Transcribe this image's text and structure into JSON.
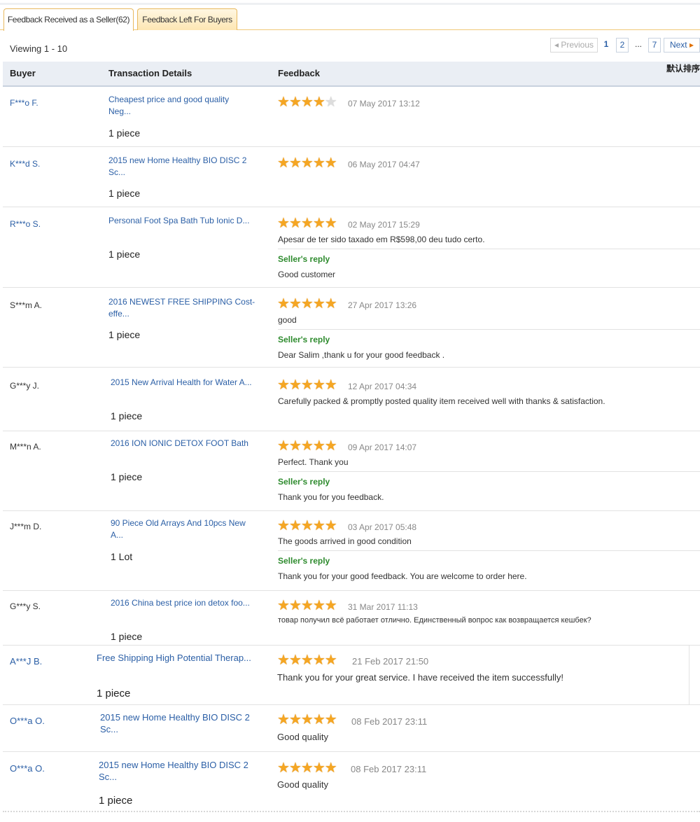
{
  "tabs": [
    {
      "label": "Feedback Received as a Seller(62)"
    },
    {
      "label": "Feedback Left For Buyers"
    }
  ],
  "viewing": "Viewing 1 - 10",
  "pager": {
    "prev": "Previous",
    "pages": [
      "1",
      "2",
      "...",
      "7"
    ],
    "next": "Next"
  },
  "columns": {
    "buyer": "Buyer",
    "transaction": "Transaction Details",
    "feedback": "Feedback",
    "sort": "默认排序"
  },
  "rows": [
    {
      "buyer": "F***o F.",
      "title1": "Cheapest price and good quality",
      "title2": "Neg...",
      "qty": "1 piece",
      "stars": 4,
      "date": "07 May 2017 13:12",
      "comment": "",
      "reply_label": "",
      "reply": ""
    },
    {
      "buyer": "K***d S.",
      "title1": "2015 new Home Healthy BIO DISC 2",
      "title2": "Sc...",
      "qty": "1 piece",
      "stars": 5,
      "date": "06 May 2017 04:47",
      "comment": "",
      "reply_label": "",
      "reply": ""
    },
    {
      "buyer": "R***o S.",
      "title1": "Personal Foot Spa Bath Tub Ionic D...",
      "title2": "",
      "qty": "1 piece",
      "stars": 5,
      "date": "02 May 2017 15:29",
      "comment": "Apesar de ter sido taxado em R$598,00 deu tudo certo.",
      "reply_label": "Seller's reply",
      "reply": "Good customer"
    },
    {
      "buyer": "S***m A.",
      "title1": "2016 NEWEST FREE SHIPPING Cost-",
      "title2": "effe...",
      "qty": "1 piece",
      "stars": 5,
      "date": "27 Apr 2017 13:26",
      "comment": "good",
      "reply_label": "Seller's reply",
      "reply": "Dear Salim ,thank u for your good feedback ."
    },
    {
      "buyer": "G***y J.",
      "title1": "2015 New Arrival Health for Water A...",
      "title2": "",
      "qty": "1 piece",
      "stars": 5,
      "date": "12 Apr 2017 04:34",
      "comment": "Carefully packed & promptly posted quality item received well with thanks & satisfaction.",
      "reply_label": "",
      "reply": ""
    },
    {
      "buyer": "M***n A.",
      "title1": "2016 ION IONIC DETOX FOOT Bath",
      "title2": "",
      "qty": "1 piece",
      "stars": 5,
      "date": "09 Apr 2017 14:07",
      "comment": "Perfect. Thank you",
      "reply_label": "Seller's reply",
      "reply": "Thank you for you feedback."
    },
    {
      "buyer": "J***m D.",
      "title1": "90 Piece Old Arrays And 10pcs New",
      "title2": "A...",
      "qty": "1 Lot",
      "stars": 5,
      "date": "03 Apr 2017 05:48",
      "comment": "The goods arrived in good condition",
      "reply_label": "Seller's reply",
      "reply": "Thank you for your good feedback. You are welcome to order here."
    },
    {
      "buyer": "G***y S.",
      "title1": "2016 China best price ion detox foo...",
      "title2": "",
      "qty": "1 piece",
      "stars": 5,
      "date": "31 Mar 2017 11:13",
      "comment": "товар получил всё работает отлично. Единственный вопрос как возвращается кешбек?",
      "reply_label": "",
      "reply": ""
    },
    {
      "buyer": "A***J B.",
      "title1": "Free Shipping High Potential Therap...",
      "title2": "",
      "qty": "1 piece",
      "stars": 5,
      "date": "21 Feb 2017 21:50",
      "comment": "Thank you for your great service. I have received the item successfully!",
      "reply_label": "",
      "reply": ""
    },
    {
      "buyer": "O***a O.",
      "title1": "2015 new Home Healthy BIO DISC 2",
      "title2": "Sc...",
      "qty": "",
      "stars": 5,
      "date": "08 Feb 2017 23:11",
      "comment": "Good quality",
      "reply_label": "",
      "reply": ""
    },
    {
      "buyer": "O***a O.",
      "title1": "2015 new Home Healthy BIO DISC 2",
      "title2": "Sc...",
      "qty": "1 piece",
      "stars": 5,
      "date": "08 Feb 2017 23:11",
      "comment": "Good quality",
      "reply_label": "",
      "reply": ""
    }
  ],
  "colors": {
    "link": "#2b5fa6",
    "star": "#f5a623",
    "reply": "#2e8b2e",
    "tab_border": "#e8b960"
  }
}
